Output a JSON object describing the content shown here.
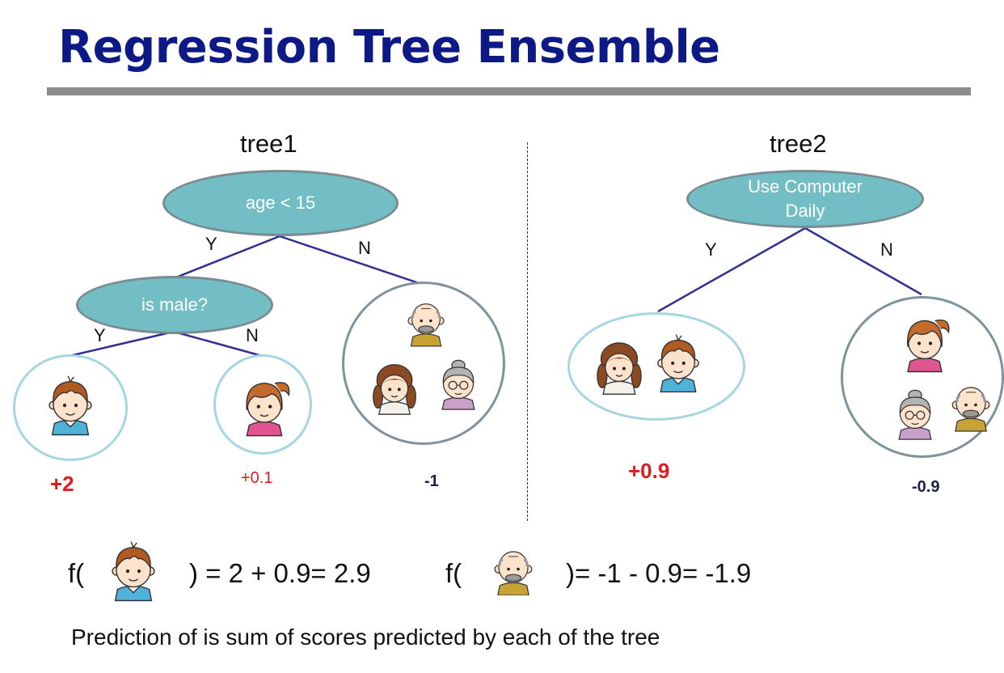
{
  "title": "Regression Tree Ensemble",
  "tree1": {
    "label": "tree1",
    "root_question": "age < 15",
    "root_yes": "Y",
    "root_no": "N",
    "child_question": "is male?",
    "child_yes": "Y",
    "child_no": "N",
    "scores": [
      "+2",
      "+0.1",
      "-1"
    ]
  },
  "tree2": {
    "label": "tree2",
    "root_question": "Use Computer Daily",
    "root_yes": "Y",
    "root_no": "N",
    "scores": [
      "+0.9",
      "-0.9"
    ]
  },
  "formulas": [
    {
      "prefix": "f(",
      "suffix": ") = 2 + 0.9= 2.9",
      "icon": "boy-icon"
    },
    {
      "prefix": "f(",
      "suffix": ")= -1 - 0.9= -1.9",
      "icon": "grandpa-icon"
    }
  ],
  "caption": "Prediction of is sum of scores predicted by each of the tree",
  "colors": {
    "title": "#0d1a86",
    "node_fill": "#72bec4",
    "edge": "#2e3192",
    "positive_score": "#e31a1c",
    "negative_score": "#1b2347"
  }
}
